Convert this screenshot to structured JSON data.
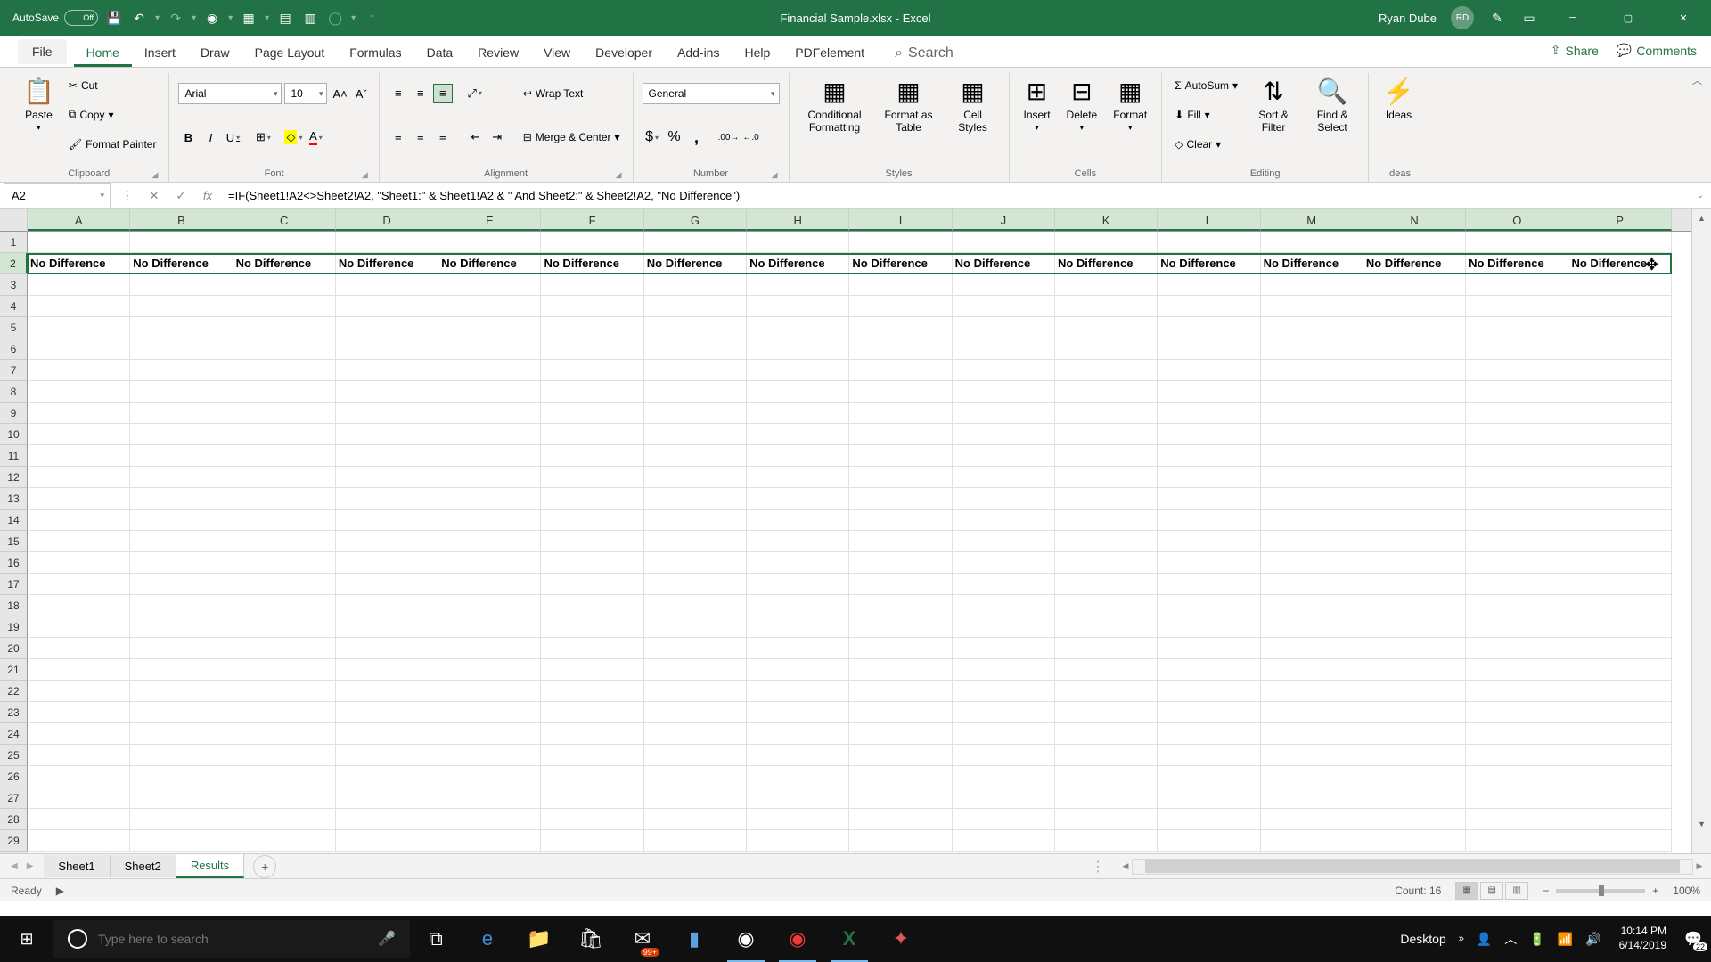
{
  "title_bar": {
    "autosave_label": "AutoSave",
    "autosave_state": "Off",
    "document_title": "Financial Sample.xlsx - Excel",
    "user_name": "Ryan Dube",
    "user_initials": "RD"
  },
  "ribbon_tabs": [
    "File",
    "Home",
    "Insert",
    "Draw",
    "Page Layout",
    "Formulas",
    "Data",
    "Review",
    "View",
    "Developer",
    "Add-ins",
    "Help",
    "PDFelement"
  ],
  "active_tab": "Home",
  "search_label": "Search",
  "share_label": "Share",
  "comments_label": "Comments",
  "ribbon": {
    "clipboard": {
      "label": "Clipboard",
      "paste": "Paste",
      "cut": "Cut",
      "copy": "Copy",
      "painter": "Format Painter"
    },
    "font": {
      "label": "Font",
      "name": "Arial",
      "size": "10"
    },
    "alignment": {
      "label": "Alignment",
      "wrap": "Wrap Text",
      "merge": "Merge & Center"
    },
    "number": {
      "label": "Number",
      "format": "General"
    },
    "styles": {
      "label": "Styles",
      "cond": "Conditional Formatting",
      "fmttable": "Format as Table",
      "cellstyles": "Cell Styles"
    },
    "cells": {
      "label": "Cells",
      "insert": "Insert",
      "delete": "Delete",
      "format": "Format"
    },
    "editing": {
      "label": "Editing",
      "autosum": "AutoSum",
      "fill": "Fill",
      "clear": "Clear",
      "sortfilter": "Sort & Filter",
      "findselect": "Find & Select"
    },
    "ideas": {
      "label": "Ideas",
      "btn": "Ideas"
    }
  },
  "formula_bar": {
    "cell_ref": "A2",
    "formula": "=IF(Sheet1!A2<>Sheet2!A2, \"Sheet1:\" & Sheet1!A2 & \" And Sheet2:\" & Sheet2!A2, \"No Difference\")"
  },
  "columns": [
    "A",
    "B",
    "C",
    "D",
    "E",
    "F",
    "G",
    "H",
    "I",
    "J",
    "K",
    "L",
    "M",
    "N",
    "O",
    "P"
  ],
  "row_count": 29,
  "data_row": {
    "row_num": 2,
    "values": [
      "No Difference",
      "No Difference",
      "No Difference",
      "No Difference",
      "No Difference",
      "No Difference",
      "No Difference",
      "No Difference",
      "No Difference",
      "No Difference",
      "No Difference",
      "No Difference",
      "No Difference",
      "No Difference",
      "No Difference",
      "No Difference"
    ]
  },
  "sheets": [
    "Sheet1",
    "Sheet2",
    "Results"
  ],
  "active_sheet": "Results",
  "status": {
    "ready": "Ready",
    "count": "Count: 16",
    "zoom": "100%"
  },
  "taskbar": {
    "search_placeholder": "Type here to search",
    "desktop_label": "Desktop",
    "time": "10:14 PM",
    "date": "6/14/2019",
    "notif_count": "22",
    "mail_badge": "99+"
  }
}
